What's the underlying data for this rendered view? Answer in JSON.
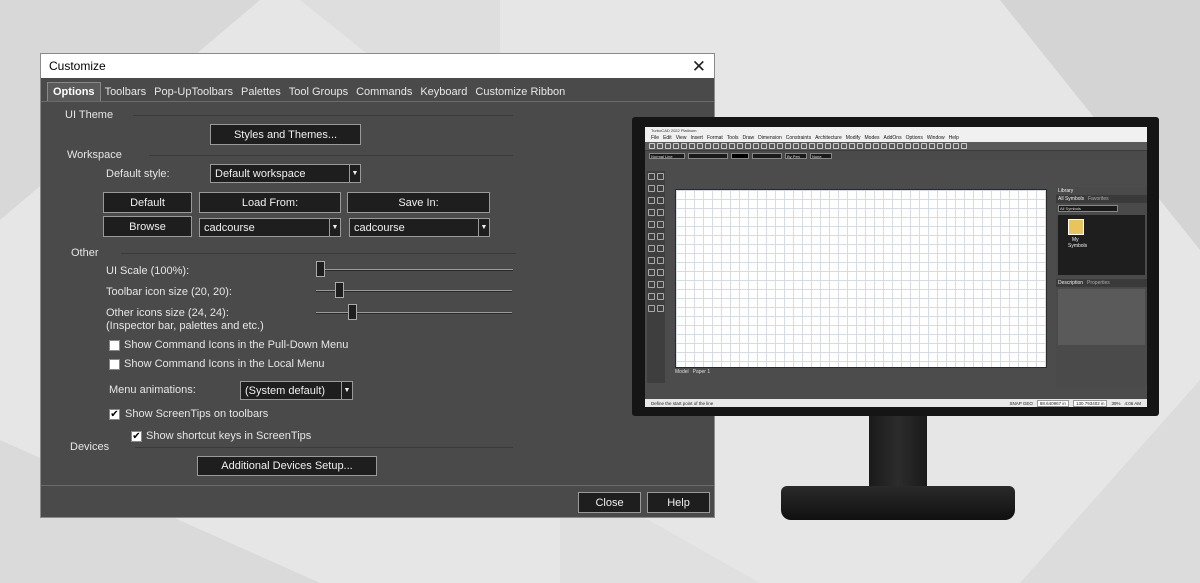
{
  "dialog": {
    "title": "Customize",
    "tabs": [
      "Options",
      "Toolbars",
      "Pop-UpToolbars",
      "Palettes",
      "Tool Groups",
      "Commands",
      "Keyboard",
      "Customize Ribbon"
    ],
    "ui_theme": {
      "heading": "UI Theme",
      "styles_button": "Styles and Themes..."
    },
    "workspace": {
      "heading": "Workspace",
      "default_style_label": "Default style:",
      "default_style_value": "Default workspace",
      "default_button": "Default",
      "load_from_button": "Load From:",
      "save_in_button": "Save In:",
      "browse_button": "Browse",
      "load_from_value": "cadcourse",
      "save_in_value": "cadcourse"
    },
    "other": {
      "heading": "Other",
      "ui_scale_label": "UI Scale (100%):",
      "ui_scale_level": 0.0,
      "toolbar_icon_label": "Toolbar icon size (20, 20):",
      "toolbar_icon_level": 0.1,
      "other_icons_label_1": "Other icons size (24, 24):",
      "other_icons_label_2": "(Inspector bar, palettes and etc.)",
      "other_icons_level": 0.17,
      "pulldown_checkbox": {
        "label": "Show Command Icons in the Pull-Down Menu",
        "checked": false
      },
      "local_checkbox": {
        "label": "Show Command Icons in the Local Menu",
        "checked": false
      },
      "menu_anim_label": "Menu animations:",
      "menu_anim_value": "(System default)",
      "screentips_checkbox": {
        "label": "Show ScreenTips on toolbars",
        "checked": true
      },
      "shortcut_checkbox": {
        "label": "Show shortcut keys in ScreenTips",
        "checked": true
      }
    },
    "devices": {
      "heading": "Devices",
      "setup_button": "Additional Devices Setup..."
    },
    "footer": {
      "close_button": "Close",
      "help_button": "Help"
    }
  },
  "monitor": {
    "app_title": "TurboCAD 2022 Platinum",
    "menu": [
      "File",
      "Edit",
      "View",
      "Insert",
      "Format",
      "Tools",
      "Draw",
      "Dimension",
      "Constraints",
      "Architecture",
      "Modify",
      "Modes",
      "AddOns",
      "Options",
      "Window",
      "Help"
    ],
    "line_style": "Normal Line",
    "pen": "By Pen",
    "fill": "None",
    "library": {
      "title": "Library",
      "tabs": [
        "All Symbols",
        "Favorites"
      ],
      "filter": "All Symbols",
      "folder_label_1": "My",
      "folder_label_2": "Symbols",
      "description_tabs": [
        "Description",
        "Properties"
      ]
    },
    "sheet_tabs": [
      "Model",
      "Paper 1"
    ],
    "status": {
      "prompt": "Define the start point of the line",
      "snap": "SNAP GEO",
      "x": "88.640967 in",
      "y": "130.793402 in",
      "zoom": "39%",
      "time": "4:06 AM"
    }
  }
}
